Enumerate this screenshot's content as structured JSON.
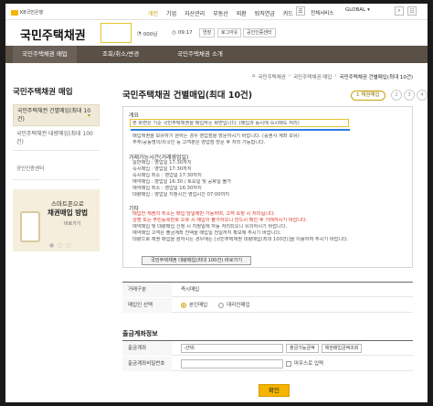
{
  "topbar": {
    "logo_text": "KB국민은행",
    "nav": [
      "개인",
      "기업",
      "자산관리",
      "부동산",
      "외환",
      "퇴직연금",
      "카드"
    ],
    "services_label": "전체서비스",
    "lang_label": "GLOBAL"
  },
  "header": {
    "brand": "국민주택채권",
    "user_label": "000님",
    "time_label": "09:17",
    "extend_label": "연장",
    "logout_label": "로그아웃",
    "cert_label": "공인인증센터"
  },
  "gnb": [
    "국민주택채권 매입",
    "조회/취소/변경",
    "국민주택채권 소개"
  ],
  "sidebar": {
    "title": "국민주택채권 매입",
    "active_item": "국민주택채권 건별매입(최대 10건)",
    "item2": "국민주택채권 대량매입(최대 100건)",
    "cert_link": "공인인증센터",
    "banner": {
      "line1": "스마트폰으로",
      "line2": "채권매입 방법",
      "line3": "바로가기"
    }
  },
  "breadcrumb": [
    "국민주택채권",
    "국민주택채권 매입",
    "국민주택채권 건별매입(최대 10건)"
  ],
  "page_title": "국민주택채권 건별매입(최대 10건)",
  "steps": {
    "current": "1 채권매입",
    "others": [
      "2",
      "3",
      "4"
    ]
  },
  "notice": {
    "section1_title": "개요",
    "s1_lines": [
      "본 화면은 기준 국민주택채권을 매입하는 화면입니다. (매입과 동시에 즉시매도 처리)",
      "매입채권을 보유하기 원하는 경우 영업점을 방문하시기 바랍니다. (증권사 계좌 보유)",
      "주주/공동명의/외국인 등 고객분은 영업점 방문 후 처리 가능합니다."
    ],
    "section2_title": "거래가능시간(거래영업일)",
    "s2_lines": [
      "일반매입 : 영업일 17:30까지",
      "즉시매입 : 영업일 17:30까지",
      "즉시매입 취소 : 영업일 17:30까지",
      "예약매입 : 영업일 16:30 / 토요일 및 공휴일 불가",
      "예약매입 취소 : 영업일 16:30까지",
      "대량매입 : 영업일 지정시간 영업시간 07:00까지"
    ],
    "section3_title": "기타",
    "s3_lines": [
      "매입한 채권의 취소는 매입 당일에만 가능하며, 고객 요청 시 처리됩니다.",
      "성명 또는 주민등록번호 오류 시 매입이 불가하오니 반드시 확인 후 거래하시기 바랍니다.",
      "예약매입 및 대량매입 신청 시 지정일에 자동 처리되오니 유의하시기 바랍니다.",
      "예약매입 고객은 출금계좌 잔액을 매입일 전일까지 확보해 주시기 바랍니다.",
      "대량으로 채권 매입을 원하시는 경우에는 [국민주택채권 대량매입(최대 100건)]을 이용하여 주시기 바랍니다."
    ],
    "bulk_button": "국민주택채권 대량매입(최대 100건) 바로가기"
  },
  "form1": {
    "rows": [
      {
        "label": "거래구분",
        "value": "즉시매입"
      },
      {
        "label": "매입인 선택",
        "opt1": "본인매입",
        "opt2": "대리인매입"
      }
    ]
  },
  "withdraw": {
    "section_title": "출금계좌정보",
    "account_label": "출금계좌",
    "account_placeholder": "-선택-",
    "balance_button": "출금가능금액",
    "lookup_button": "채권매입금액조회",
    "password_label": "출금계좌비밀번호",
    "keypad_label": "마우스로 입력"
  },
  "confirm_button": "확인"
}
